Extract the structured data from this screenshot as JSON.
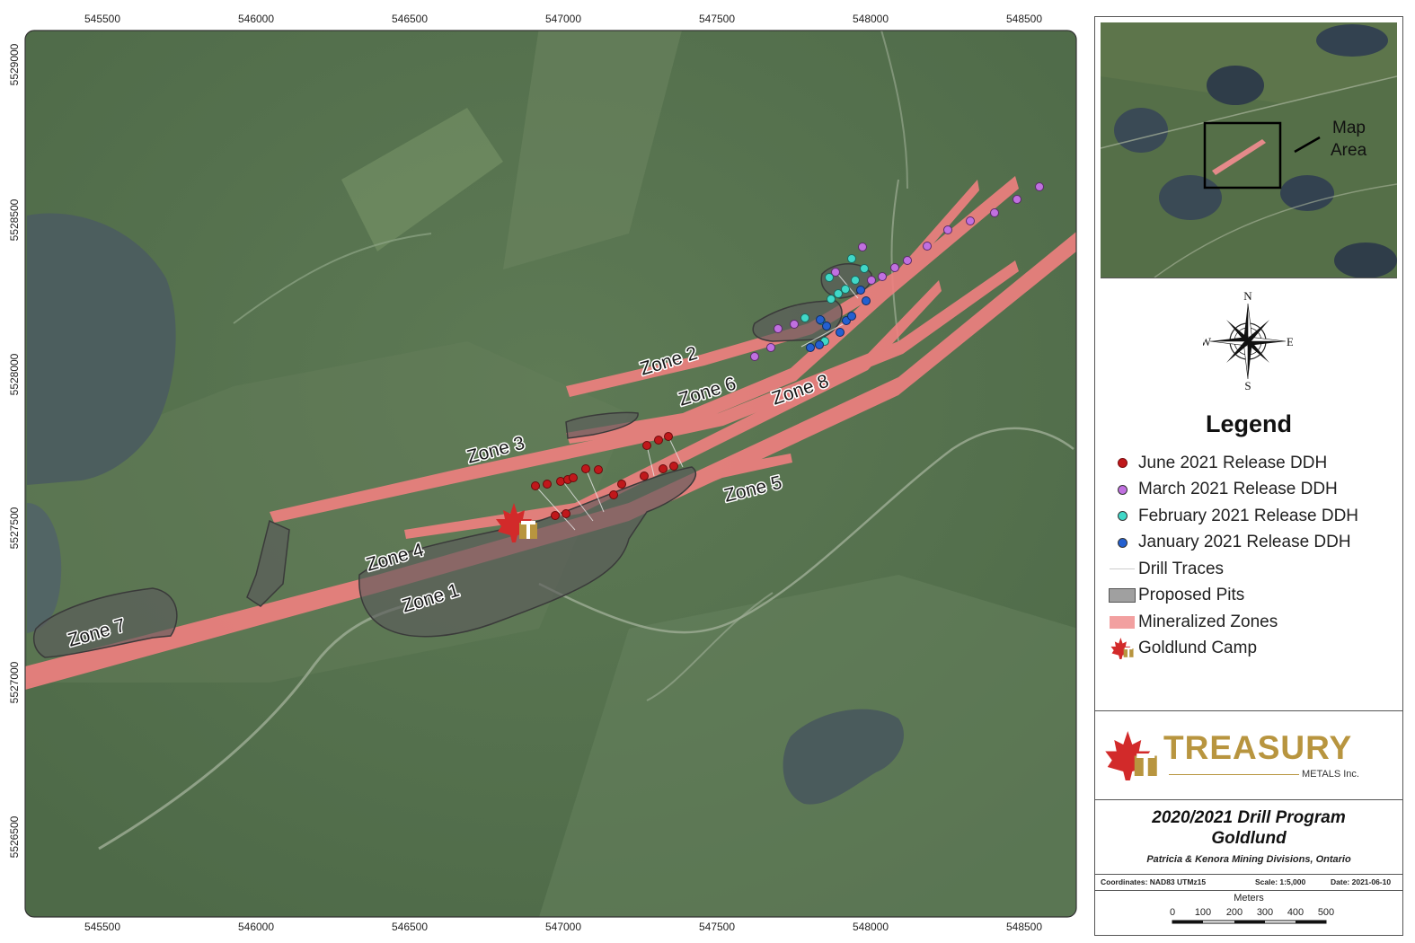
{
  "map": {
    "x_ticks": [
      "545500",
      "546000",
      "546500",
      "547000",
      "547500",
      "548000",
      "548500"
    ],
    "y_ticks": [
      "5529000",
      "5528500",
      "5528000",
      "5527500",
      "5527000",
      "5526500"
    ],
    "zone_labels": [
      "Zone 2",
      "Zone 6",
      "Zone 8",
      "Zone 3",
      "Zone 5",
      "Zone 4",
      "Zone 1",
      "Zone 7"
    ],
    "colors": {
      "mineralized_zone": "#f08080",
      "proposed_pit": "#5a5a5a",
      "june": "#c0181b",
      "march": "#c070e0",
      "february": "#40d8c8",
      "january": "#2460d0",
      "drill_trace": "#e8e8e8"
    }
  },
  "inset": {
    "label_line1": "Map",
    "label_line2": "Area"
  },
  "north_arrow": {
    "n": "N",
    "s": "S",
    "e": "E",
    "w": "W"
  },
  "legend": {
    "title": "Legend",
    "items": [
      {
        "label": "June 2021 Release DDH",
        "icon": "red-dot"
      },
      {
        "label": "March 2021 Release DDH",
        "icon": "purple-dot"
      },
      {
        "label": "February 2021 Release DDH",
        "icon": "cyan-dot"
      },
      {
        "label": "January 2021 Release DDH",
        "icon": "blue-dot"
      },
      {
        "label": "Drill Traces",
        "icon": "white-line"
      },
      {
        "label": "Proposed Pits",
        "icon": "gray-box"
      },
      {
        "label": "Mineralized Zones",
        "icon": "pink-box"
      },
      {
        "label": "Goldlund Camp",
        "icon": "maple-leaf-icon"
      }
    ]
  },
  "logo": {
    "word": "TREASURY",
    "sub": "METALS Inc."
  },
  "title_block": {
    "line1": "2020/2021 Drill Program",
    "line2": "Goldlund",
    "subtitle": "Patricia & Kenora Mining Divisions, Ontario"
  },
  "info": {
    "coordinates": "Coordinates: NAD83 UTMz15",
    "scale": "Scale: 1:5,000",
    "date": "Date: 2021-06-10"
  },
  "scale_bar": {
    "title": "Meters",
    "labels": [
      "0",
      "100",
      "200",
      "300",
      "400",
      "500"
    ]
  }
}
